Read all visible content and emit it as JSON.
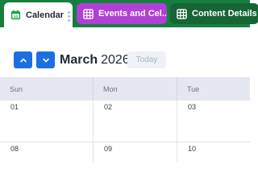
{
  "tabs": [
    {
      "label": "Calendar",
      "icon": "calendar-icon"
    },
    {
      "label": "Events and Cel...",
      "icon": "table-icon"
    },
    {
      "label": "Content Details",
      "icon": "table-icon"
    }
  ],
  "toolbar": {
    "prev_icon": "chevron-up-icon",
    "next_icon": "chevron-down-icon",
    "month": "March",
    "year": "2026",
    "today_label": "Today"
  },
  "calendar": {
    "weekdays": [
      "Sun",
      "Mon",
      "Tue"
    ],
    "weeks": [
      [
        "01",
        "02",
        "03"
      ],
      [
        "08",
        "09",
        "10"
      ]
    ]
  },
  "colors": {
    "tab_strip": "#15803d",
    "tab_events": "#b23fd6",
    "tab_content": "#166534",
    "accent_button": "#1d6fe0",
    "header_band": "#e5e7f0"
  }
}
